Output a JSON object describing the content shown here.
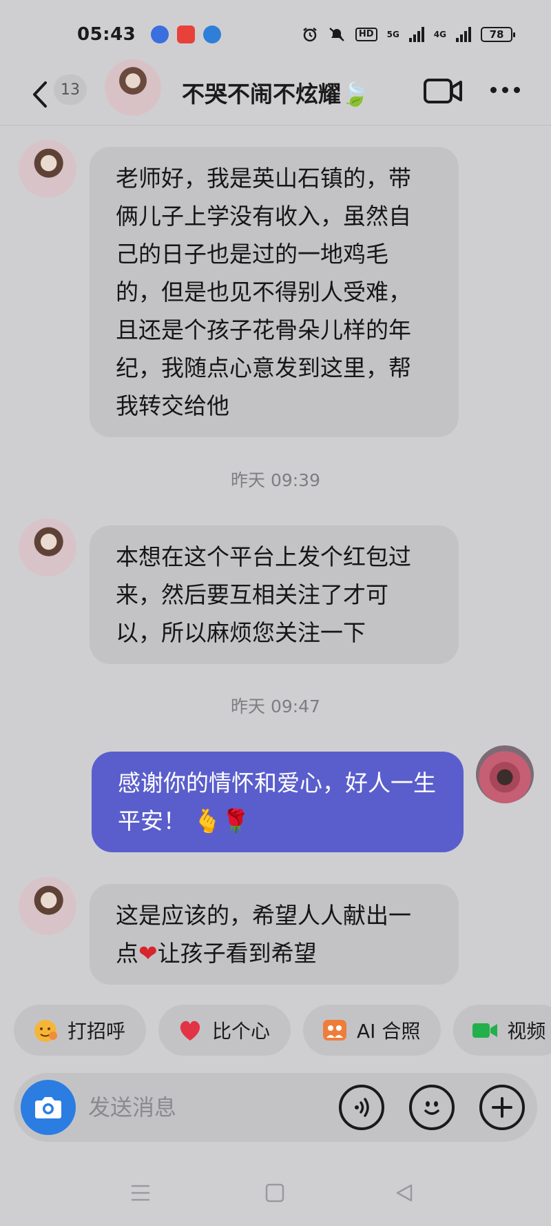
{
  "status_bar": {
    "time": "05:43",
    "hd": "HD",
    "net1": "5G",
    "net2": "4G",
    "battery": "78"
  },
  "header": {
    "unread_count": "13",
    "title": "不哭不闹不炫耀🍃"
  },
  "messages": [
    {
      "from": "other",
      "text": "老师好，我是英山石镇的，带俩儿子上学没有收入，虽然自己的日子也是过的一地鸡毛的，但是也见不得别人受难，且还是个孩子花骨朵儿样的年纪，我随点心意发到这里，帮我转交给他"
    },
    {
      "timestamp": "昨天 09:39"
    },
    {
      "from": "other",
      "text": "本想在这个平台上发个红包过来，然后要互相关注了才可以，所以麻烦您关注一下"
    },
    {
      "timestamp": "昨天 09:47"
    },
    {
      "from": "self",
      "text_main": "感谢你的情怀和爱心，好人一生平安！",
      "emoji": "🫰🌹"
    },
    {
      "from": "other",
      "text_before": "这是应该的，希望人人献出一点",
      "emoji": "❤",
      "text_after": "让孩子看到希望"
    }
  ],
  "quick_replies": [
    {
      "label": "打招呼",
      "icon": "wave-emoji-icon"
    },
    {
      "label": "比个心",
      "icon": "heart-icon"
    },
    {
      "label": "AI 合照",
      "icon": "ai-photo-icon"
    },
    {
      "label": "视频",
      "icon": "video-icon"
    }
  ],
  "input": {
    "placeholder": "发送消息"
  },
  "colors": {
    "background": "#cfcfd2",
    "bubble_in": "#c3c3c6",
    "bubble_out": "#5a5ecc",
    "camera_button": "#2b7de2"
  }
}
